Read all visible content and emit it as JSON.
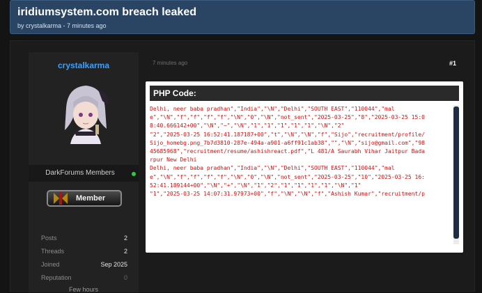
{
  "thread": {
    "title": "iridiumsystem.com breach leaked",
    "byline": "by crystalkarma - 7 minutes ago"
  },
  "author": {
    "name": "crystalkarma",
    "group": "DarkForums Members",
    "badge": "Member",
    "stats": [
      {
        "key": "Posts",
        "value": "2"
      },
      {
        "key": "Threads",
        "value": "2"
      },
      {
        "key": "Joined",
        "value": "Sep 2025"
      },
      {
        "key": "Reputation",
        "value": "0"
      }
    ],
    "last_visit": "Few hours"
  },
  "post": {
    "time": "7 minutes ago",
    "number": "#1",
    "code_title": "PHP Code:",
    "code_lines": [
      "Delhi, neer baba pradhan\",\"India\",\"\\N\",\"Delhi\",\"SOUTH EAST\",\"110044\",\"mal",
      "e\",\"\\N\",\"f\",\"f\",\"f\",\"f\",\"\\N\",\"0\",\"\\N\",\"not_sent\",\"2025-03-25\",\"8\",\"2025-03-25 15:0",
      "8:40.666142+00\",\"\\N\",\"~\",\"\\N\",\"1\",\"1\",\"1\",\"1\",\"1\",\"\\N\",\"2\"",
      "\"2\",\"2025-03-25 16:52:41.187187+00\",\"t\",\"\\N\",\"\\N\",\"f\",\"Sijo\",\"recruitment/profile/",
      "Sijo_homebg.png_7b7d3810-287e-494a-a901-a6ff91c1ab38\",\"\",\"\\N\",\"sijo@gmail.com\",\"98",
      "45685968\",\"recruitment/resume/ashishreact.pdf\",\"L 481/A Saurabh Vihar Jaitpur Bada",
      "rpur New Delhi",
      "Delhi, neer baba pradhan\",\"India\",\"\\N\",\"Delhi\",\"SOUTH EAST\",\"110044\",\"mal",
      "e\",\"\\N\",\"f\",\"f\",\"f\",\"f\",\"\\N\",\"0\",\"\\N\",\"not_sent\",\"2025-03-25\",\"10\",\"2025-03-25 16:",
      "52:41.189144+00\",\"\\N\",\"+\",\"\\N\",\"1\",\"2\",\"1\",\"1\",\"1\",\"1\",\"\\N\",\"1\"",
      "\"1\",\"2025-03-25 14:07:31.97973+00\",\"f\",\"\\N\",\"\\N\",\"f\",\"Ashish Kumar\",\"recruitment/p"
    ]
  },
  "colors": {
    "header_bg": "#2a4563",
    "username": "#3aa0ff",
    "code_text": "#cc1111",
    "online": "#2ecc40"
  },
  "icons": [
    "avatar-image",
    "member-emblem-icon",
    "online-status-icon"
  ]
}
